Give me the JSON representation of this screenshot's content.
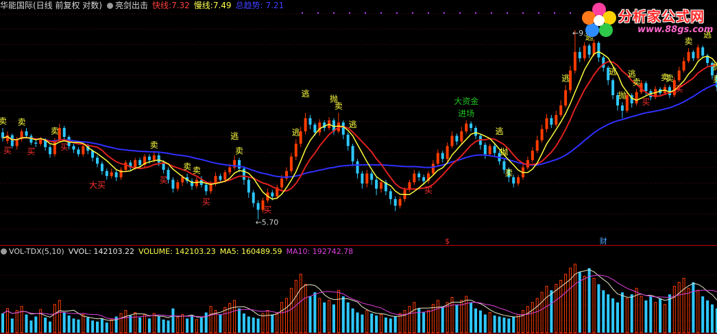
{
  "header": {
    "stock": "华能国际(日线 前复权 对数)",
    "indicator_name": "亮剑出击",
    "fast_label": "快线:",
    "fast_value": "7.32",
    "slow_label": "慢线:",
    "slow_value": "7.49",
    "trend_label": "总趋势:",
    "trend_value": "7.21"
  },
  "volume_header": {
    "name": "VOL-TDX(5,10)",
    "vvol": "VVOL: 142103.22",
    "volume": "VOLUME: 142103.23",
    "ma5": "MA5: 160489.59",
    "ma10": "MA10: 192742.78"
  },
  "watermark": {
    "name": "分析家公式网",
    "url": "www.88gs.com"
  },
  "colors": {
    "background": "#000000",
    "up_candle": "#ff3c00",
    "down_candle": "#2ec8ff",
    "fast_line": "#ffff40",
    "slow_line": "#e02020",
    "trend_line": "#3030ff",
    "ma5_line": "#e8e8c8",
    "ma10_line": "#e040e0",
    "buy_text": "#ff3030",
    "sell_text": "#ffff40",
    "capital_text": "#20c020",
    "separator": "#c00000",
    "tick_dots": "#c040ff"
  },
  "chart_data": {
    "type": "candlestick",
    "price_scale": "log",
    "price_range": [
      5.55,
      9.45
    ],
    "extremes": {
      "high": "9.19",
      "low": "5.70"
    },
    "candles": [
      [
        7.1,
        7.0,
        7.18,
        6.94
      ],
      [
        6.95,
        7.05,
        7.12,
        6.9
      ],
      [
        7.05,
        6.86,
        7.08,
        6.82
      ],
      [
        6.86,
        6.98,
        7.02,
        6.8
      ],
      [
        6.98,
        7.12,
        7.16,
        6.94
      ],
      [
        7.12,
        7.04,
        7.18,
        7.0
      ],
      [
        7.04,
        6.92,
        7.07,
        6.88
      ],
      [
        6.92,
        6.9,
        6.98,
        6.84
      ],
      [
        6.9,
        6.98,
        7.02,
        6.86
      ],
      [
        6.98,
        6.84,
        7.0,
        6.78
      ],
      [
        6.84,
        6.72,
        6.88,
        6.66
      ],
      [
        6.72,
        6.96,
        7.0,
        6.68
      ],
      [
        6.96,
        7.18,
        7.26,
        6.92
      ],
      [
        7.18,
        7.02,
        7.22,
        6.96
      ],
      [
        7.02,
        6.86,
        7.05,
        6.8
      ],
      [
        6.86,
        6.8,
        6.9,
        6.74
      ],
      [
        6.8,
        6.72,
        6.84,
        6.68
      ],
      [
        6.72,
        6.86,
        6.9,
        6.68
      ],
      [
        6.86,
        6.78,
        6.9,
        6.72
      ],
      [
        6.78,
        6.66,
        6.8,
        6.6
      ],
      [
        6.66,
        6.56,
        6.7,
        6.5
      ],
      [
        6.56,
        6.44,
        6.6,
        6.38
      ],
      [
        6.44,
        6.36,
        6.48,
        6.3
      ],
      [
        6.36,
        6.42,
        6.48,
        6.32
      ],
      [
        6.42,
        6.34,
        6.46,
        6.28
      ],
      [
        6.34,
        6.46,
        6.5,
        6.3
      ],
      [
        6.46,
        6.58,
        6.62,
        6.42
      ],
      [
        6.58,
        6.5,
        6.62,
        6.44
      ],
      [
        6.5,
        6.62,
        6.66,
        6.46
      ],
      [
        6.62,
        6.54,
        6.66,
        6.5
      ],
      [
        6.54,
        6.68,
        6.72,
        6.5
      ],
      [
        6.68,
        6.62,
        6.72,
        6.56
      ],
      [
        6.62,
        6.7,
        6.76,
        6.58
      ],
      [
        6.7,
        6.58,
        6.74,
        6.52
      ],
      [
        6.58,
        6.46,
        6.62,
        6.4
      ],
      [
        6.46,
        6.3,
        6.5,
        6.24
      ],
      [
        6.3,
        6.16,
        6.34,
        6.1
      ],
      [
        6.16,
        6.26,
        6.3,
        6.12
      ],
      [
        6.26,
        6.34,
        6.38,
        6.2
      ],
      [
        6.34,
        6.28,
        6.4,
        6.24
      ],
      [
        6.28,
        6.2,
        6.32,
        6.14
      ],
      [
        6.2,
        6.3,
        6.34,
        6.16
      ],
      [
        6.3,
        6.22,
        6.36,
        6.18
      ],
      [
        6.22,
        6.12,
        6.26,
        6.06
      ],
      [
        6.12,
        6.24,
        6.28,
        6.08
      ],
      [
        6.24,
        6.36,
        6.42,
        6.2
      ],
      [
        6.36,
        6.3,
        6.4,
        6.26
      ],
      [
        6.3,
        6.42,
        6.46,
        6.26
      ],
      [
        6.42,
        6.5,
        6.56,
        6.38
      ],
      [
        6.5,
        6.62,
        6.7,
        6.46
      ],
      [
        6.62,
        6.48,
        6.66,
        6.42
      ],
      [
        6.48,
        6.3,
        6.52,
        6.22
      ],
      [
        6.3,
        6.1,
        6.34,
        6.02
      ],
      [
        6.1,
        5.94,
        6.14,
        5.88
      ],
      [
        5.94,
        5.84,
        5.98,
        5.7
      ],
      [
        5.84,
        5.98,
        6.02,
        5.8
      ],
      [
        5.98,
        6.1,
        6.16,
        5.94
      ],
      [
        6.1,
        6.04,
        6.14,
        5.98
      ],
      [
        6.04,
        6.18,
        6.22,
        6.0
      ],
      [
        6.18,
        6.32,
        6.38,
        6.14
      ],
      [
        6.32,
        6.44,
        6.5,
        6.28
      ],
      [
        6.44,
        6.68,
        6.74,
        6.4
      ],
      [
        6.68,
        6.9,
        6.98,
        6.62
      ],
      [
        6.9,
        7.12,
        7.2,
        6.84
      ],
      [
        7.12,
        7.36,
        7.46,
        7.06
      ],
      [
        7.36,
        7.24,
        7.42,
        7.16
      ],
      [
        7.24,
        7.1,
        7.28,
        7.04
      ],
      [
        7.1,
        7.28,
        7.34,
        7.04
      ],
      [
        7.28,
        7.18,
        7.32,
        7.12
      ],
      [
        7.18,
        7.32,
        7.38,
        7.14
      ],
      [
        7.32,
        7.12,
        7.36,
        7.06
      ],
      [
        7.12,
        7.28,
        7.46,
        7.08
      ],
      [
        7.28,
        7.06,
        7.32,
        6.98
      ],
      [
        7.06,
        6.86,
        7.1,
        6.78
      ],
      [
        6.86,
        6.6,
        6.9,
        6.52
      ],
      [
        6.6,
        6.4,
        6.64,
        6.32
      ],
      [
        6.4,
        6.24,
        6.44,
        6.16
      ],
      [
        6.24,
        6.4,
        6.46,
        6.18
      ],
      [
        6.4,
        6.3,
        6.44,
        6.22
      ],
      [
        6.3,
        6.16,
        6.34,
        6.06
      ],
      [
        6.16,
        6.26,
        6.3,
        6.1
      ],
      [
        6.26,
        6.12,
        6.3,
        6.06
      ],
      [
        6.12,
        6.0,
        6.16,
        5.92
      ],
      [
        6.0,
        5.9,
        6.04,
        5.82
      ],
      [
        5.9,
        6.0,
        6.04,
        5.86
      ],
      [
        6.0,
        6.14,
        6.18,
        5.96
      ],
      [
        6.14,
        6.26,
        6.3,
        6.1
      ],
      [
        6.26,
        6.4,
        6.46,
        6.22
      ],
      [
        6.4,
        6.34,
        6.44,
        6.28
      ],
      [
        6.34,
        6.28,
        6.38,
        6.22
      ],
      [
        6.28,
        6.4,
        6.44,
        6.24
      ],
      [
        6.4,
        6.56,
        6.62,
        6.36
      ],
      [
        6.56,
        6.74,
        6.8,
        6.52
      ],
      [
        6.74,
        6.64,
        6.78,
        6.58
      ],
      [
        6.64,
        6.86,
        6.92,
        6.6
      ],
      [
        6.86,
        7.04,
        7.12,
        6.82
      ],
      [
        7.04,
        6.94,
        7.08,
        6.88
      ],
      [
        6.94,
        7.12,
        7.2,
        6.9
      ],
      [
        7.12,
        7.26,
        7.32,
        7.08
      ],
      [
        7.26,
        7.18,
        7.3,
        7.12
      ],
      [
        7.18,
        7.04,
        7.22,
        6.98
      ],
      [
        7.04,
        6.88,
        7.08,
        6.8
      ],
      [
        6.88,
        6.72,
        6.92,
        6.64
      ],
      [
        6.72,
        6.86,
        6.9,
        6.68
      ],
      [
        6.86,
        6.74,
        6.9,
        6.68
      ],
      [
        6.74,
        6.6,
        6.78,
        6.54
      ],
      [
        6.6,
        6.46,
        6.64,
        6.4
      ],
      [
        6.46,
        6.34,
        6.5,
        6.26
      ],
      [
        6.34,
        6.24,
        6.38,
        6.18
      ],
      [
        6.24,
        6.34,
        6.38,
        6.2
      ],
      [
        6.34,
        6.5,
        6.56,
        6.3
      ],
      [
        6.5,
        6.62,
        6.68,
        6.46
      ],
      [
        6.62,
        6.78,
        6.84,
        6.58
      ],
      [
        6.78,
        6.96,
        7.04,
        6.74
      ],
      [
        6.96,
        7.16,
        7.24,
        6.92
      ],
      [
        7.16,
        7.36,
        7.44,
        7.1
      ],
      [
        7.36,
        7.24,
        7.42,
        7.18
      ],
      [
        7.24,
        7.42,
        7.5,
        7.2
      ],
      [
        7.42,
        7.6,
        7.7,
        7.38
      ],
      [
        7.6,
        7.9,
        8.0,
        7.56
      ],
      [
        7.9,
        8.3,
        8.4,
        7.84
      ],
      [
        8.3,
        8.7,
        9.19,
        8.24
      ],
      [
        8.7,
        8.56,
        8.8,
        8.48
      ],
      [
        8.56,
        8.84,
        8.92,
        8.5
      ],
      [
        8.84,
        8.64,
        8.88,
        8.56
      ],
      [
        8.64,
        8.9,
        8.98,
        8.6
      ],
      [
        8.9,
        8.58,
        8.94,
        8.48
      ],
      [
        8.58,
        8.36,
        8.62,
        8.28
      ],
      [
        8.36,
        8.1,
        8.4,
        8.0
      ],
      [
        8.1,
        7.8,
        8.14,
        7.72
      ],
      [
        7.8,
        7.6,
        7.86,
        7.5
      ],
      [
        7.6,
        7.5,
        7.66,
        7.36
      ],
      [
        7.5,
        7.8,
        7.88,
        7.46
      ],
      [
        7.8,
        7.64,
        7.84,
        7.56
      ],
      [
        7.64,
        7.86,
        7.92,
        7.6
      ],
      [
        7.86,
        8.04,
        8.1,
        7.82
      ],
      [
        8.04,
        7.88,
        8.08,
        7.8
      ],
      [
        7.88,
        7.76,
        7.92,
        7.7
      ],
      [
        7.76,
        7.92,
        7.98,
        7.72
      ],
      [
        7.92,
        7.84,
        7.96,
        7.78
      ],
      [
        7.84,
        7.96,
        8.02,
        7.8
      ],
      [
        7.96,
        7.8,
        8.0,
        7.74
      ],
      [
        7.8,
        8.1,
        8.16,
        7.76
      ],
      [
        8.1,
        8.3,
        8.38,
        8.06
      ],
      [
        8.3,
        8.5,
        8.58,
        8.26
      ],
      [
        8.5,
        8.7,
        8.78,
        8.46
      ],
      [
        8.7,
        8.56,
        8.74,
        8.5
      ],
      [
        8.56,
        8.8,
        8.86,
        8.52
      ],
      [
        8.8,
        8.62,
        8.84,
        8.56
      ],
      [
        8.62,
        8.46,
        8.66,
        8.4
      ],
      [
        8.46,
        8.2,
        8.5,
        8.12
      ],
      [
        8.2,
        7.96,
        8.24,
        7.88
      ],
      [
        7.96,
        7.74,
        8.0,
        7.66
      ],
      [
        7.74,
        7.5,
        7.78,
        7.42
      ]
    ],
    "volumes": [
      95,
      120,
      70,
      110,
      130,
      90,
      60,
      80,
      115,
      75,
      55,
      140,
      160,
      100,
      85,
      70,
      65,
      90,
      75,
      60,
      55,
      70,
      50,
      65,
      80,
      95,
      110,
      85,
      100,
      75,
      90,
      70,
      95,
      80,
      65,
      60,
      120,
      75,
      90,
      70,
      85,
      65,
      75,
      100,
      130,
      110,
      90,
      125,
      145,
      160,
      120,
      95,
      80,
      75,
      70,
      95,
      110,
      90,
      100,
      150,
      170,
      220,
      260,
      290,
      240,
      180,
      200,
      170,
      150,
      160,
      140,
      210,
      180,
      150,
      120,
      100,
      90,
      110,
      95,
      85,
      90,
      75,
      70,
      80,
      95,
      110,
      130,
      150,
      120,
      100,
      110,
      140,
      160,
      130,
      150,
      175,
      140,
      160,
      180,
      150,
      120,
      110,
      90,
      100,
      85,
      80,
      75,
      70,
      80,
      90,
      110,
      130,
      150,
      170,
      200,
      230,
      210,
      240,
      260,
      290,
      320,
      340,
      300,
      280,
      320,
      270,
      240,
      210,
      190,
      170,
      150,
      200,
      170,
      190,
      220,
      180,
      160,
      180,
      150,
      170,
      140,
      190,
      230,
      250,
      270,
      220,
      250,
      210,
      180,
      160,
      140,
      120,
      100
    ]
  },
  "annotations": [
    {
      "i": 0,
      "text": "卖",
      "color": "sell",
      "pos": "above"
    },
    {
      "i": 1,
      "text": "买",
      "color": "buy",
      "pos": "below"
    },
    {
      "i": 4,
      "text": "卖",
      "color": "sell",
      "pos": "above"
    },
    {
      "i": 6,
      "text": "买",
      "color": "buy",
      "pos": "below"
    },
    {
      "i": 11,
      "text": "卖",
      "color": "sell",
      "pos": "above"
    },
    {
      "i": 13,
      "text": "买",
      "color": "buy",
      "pos": "below"
    },
    {
      "i": 20,
      "text": "大买",
      "color": "buy",
      "pos": "low2"
    },
    {
      "i": 32,
      "text": "卖",
      "color": "sell",
      "pos": "above"
    },
    {
      "i": 34,
      "text": "买",
      "color": "buy",
      "pos": "below"
    },
    {
      "i": 39,
      "text": "卖",
      "color": "sell",
      "pos": "above"
    },
    {
      "i": 41,
      "text": "卖",
      "color": "sell",
      "pos": "above"
    },
    {
      "i": 43,
      "text": "买",
      "color": "buy",
      "pos": "below"
    },
    {
      "i": 49,
      "text": "逃",
      "color": "sell",
      "pos": "high2"
    },
    {
      "i": 50,
      "text": "卖",
      "color": "sell",
      "pos": "above"
    },
    {
      "i": 56,
      "text": "买",
      "color": "buy",
      "pos": "below"
    },
    {
      "i": 62,
      "text": "逃",
      "color": "sell",
      "pos": "above"
    },
    {
      "i": 64,
      "text": "逃",
      "color": "sell",
      "pos": "high2"
    },
    {
      "i": 70,
      "text": "抛",
      "color": "sell",
      "pos": "high2"
    },
    {
      "i": 71,
      "text": "卖",
      "color": "sell",
      "pos": "above"
    },
    {
      "i": 74,
      "text": "逃",
      "color": "sell",
      "pos": "high2"
    },
    {
      "i": 90,
      "text": "买",
      "color": "buy",
      "pos": "below"
    },
    {
      "i": 98,
      "text": "大资金",
      "color": "capital",
      "pos": "high2"
    },
    {
      "i": 98,
      "text": "进场",
      "color": "capital",
      "pos": "above"
    },
    {
      "i": 105,
      "text": "逃",
      "color": "sell",
      "pos": "high2"
    },
    {
      "i": 106,
      "text": "抛",
      "color": "sell",
      "pos": "above"
    },
    {
      "i": 107,
      "text": "卖",
      "color": "sell",
      "pos": "mid"
    },
    {
      "i": 119,
      "text": "逃",
      "color": "sell",
      "pos": "above"
    },
    {
      "i": 124,
      "text": "逃",
      "color": "sell",
      "pos": "above"
    },
    {
      "i": 129,
      "text": "逃",
      "color": "sell",
      "pos": "above"
    },
    {
      "i": 131,
      "text": "抛",
      "color": "sell",
      "pos": "above"
    },
    {
      "i": 133,
      "text": "逃",
      "color": "sell",
      "pos": "high2"
    },
    {
      "i": 134,
      "text": "卖",
      "color": "sell",
      "pos": "above"
    },
    {
      "i": 136,
      "text": "买",
      "color": "buy",
      "pos": "below"
    },
    {
      "i": 140,
      "text": "卖",
      "color": "sell",
      "pos": "above"
    },
    {
      "i": 141,
      "text": "卖",
      "color": "sell",
      "pos": "above"
    },
    {
      "i": 143,
      "text": "买",
      "color": "buy",
      "pos": "below"
    },
    {
      "i": 145,
      "text": "卖",
      "color": "sell",
      "pos": "above"
    },
    {
      "i": 149,
      "text": "逃",
      "color": "sell",
      "pos": "high2"
    },
    {
      "i": 151,
      "text": "抛",
      "color": "sell",
      "pos": "above"
    },
    {
      "i": 151,
      "text": "卖",
      "color": "sell",
      "pos": "mid"
    }
  ],
  "event_markers": [
    {
      "i": 94,
      "text": "$",
      "color": "#ff3030"
    },
    {
      "i": 127,
      "text": "财",
      "color": "#4da6ff"
    }
  ]
}
